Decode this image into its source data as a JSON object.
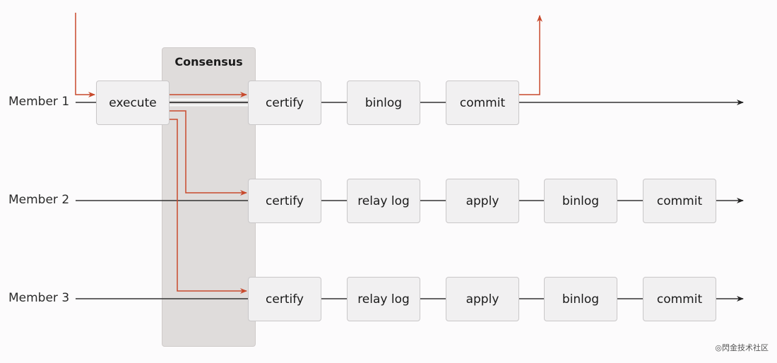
{
  "diagram": {
    "consensus_label": "Consensus",
    "members": [
      {
        "label": "Member 1",
        "stages": [
          "execute",
          "certify",
          "binlog",
          "commit"
        ]
      },
      {
        "label": "Member 2",
        "stages": [
          "certify",
          "relay log",
          "apply",
          "binlog",
          "commit"
        ]
      },
      {
        "label": "Member 3",
        "stages": [
          "certify",
          "relay log",
          "apply",
          "binlog",
          "commit"
        ]
      }
    ],
    "colors": {
      "flow": "#c8492c",
      "timeline": "#333333",
      "box_fill": "#f1f0f1",
      "consensus_fill": "#dfdcdb"
    }
  },
  "watermark": "◎閃金技术社区"
}
